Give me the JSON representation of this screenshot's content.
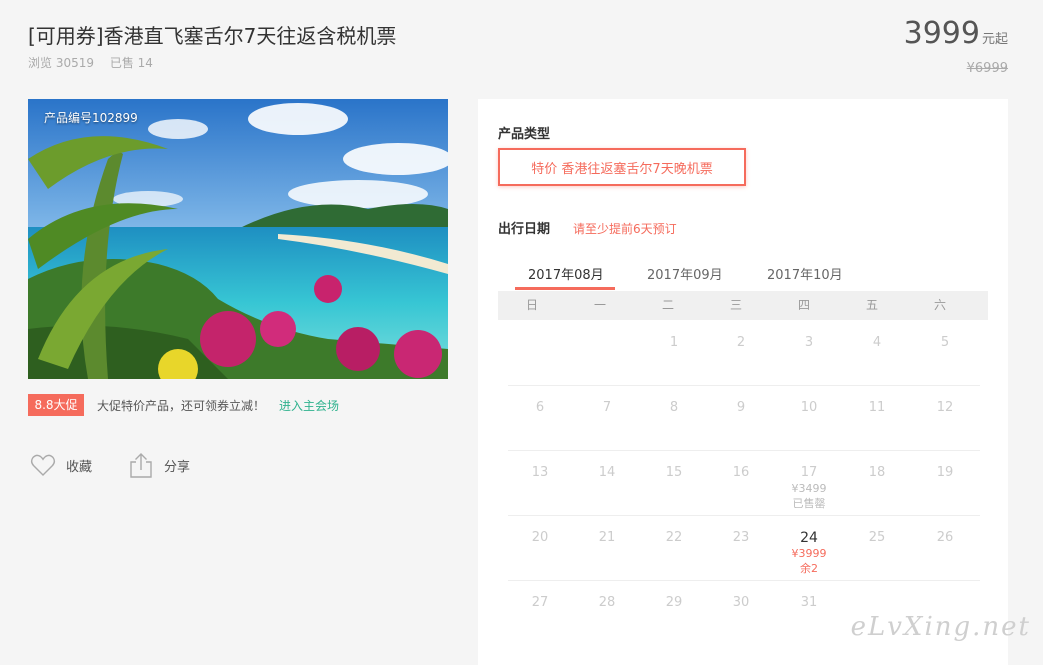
{
  "header": {
    "title": "[可用券]香港直飞塞舌尔7天往返含税机票",
    "views": "浏览 30519",
    "sold": "已售 14",
    "price": "3999",
    "price_unit": "元起",
    "original_price": "¥6999"
  },
  "product": {
    "code": "产品编号102899",
    "promo_badge": "8.8大促",
    "promo_text": "大促特价产品，还可领券立减！",
    "promo_link": "进入主会场",
    "favorite_label": "收藏",
    "share_label": "分享"
  },
  "booking": {
    "product_type_label": "产品类型",
    "product_type_option": "特价 香港往返塞舌尔7天晚机票",
    "date_label": "出行日期",
    "date_hint": "请至少提前6天预订",
    "months": [
      "2017年08月",
      "2017年09月",
      "2017年10月"
    ],
    "active_month": "2017年08月",
    "weekdays": [
      "日",
      "一",
      "二",
      "三",
      "四",
      "五",
      "六"
    ],
    "calendar_rows": [
      [
        null,
        null,
        {
          "day": "1"
        },
        {
          "day": "2"
        },
        {
          "day": "3"
        },
        {
          "day": "4"
        },
        {
          "day": "5"
        }
      ],
      [
        {
          "day": "6"
        },
        {
          "day": "7"
        },
        {
          "day": "8"
        },
        {
          "day": "9"
        },
        {
          "day": "10"
        },
        {
          "day": "11"
        },
        {
          "day": "12"
        }
      ],
      [
        {
          "day": "13"
        },
        {
          "day": "14"
        },
        {
          "day": "15"
        },
        {
          "day": "16"
        },
        {
          "day": "17",
          "price": "¥3499",
          "status": "已售罄",
          "state": "soldout"
        },
        {
          "day": "18"
        },
        {
          "day": "19"
        }
      ],
      [
        {
          "day": "20"
        },
        {
          "day": "21"
        },
        {
          "day": "22"
        },
        {
          "day": "23"
        },
        {
          "day": "24",
          "price": "¥3999",
          "status": "余2",
          "state": "available"
        },
        {
          "day": "25"
        },
        {
          "day": "26"
        }
      ],
      [
        {
          "day": "27"
        },
        {
          "day": "28"
        },
        {
          "day": "29"
        },
        {
          "day": "30"
        },
        {
          "day": "31"
        },
        null,
        null
      ]
    ]
  },
  "watermark": "eLvXing.net",
  "colors": {
    "accent": "#f56b5c",
    "link": "#2fb28e",
    "background": "#f5f5f5"
  }
}
